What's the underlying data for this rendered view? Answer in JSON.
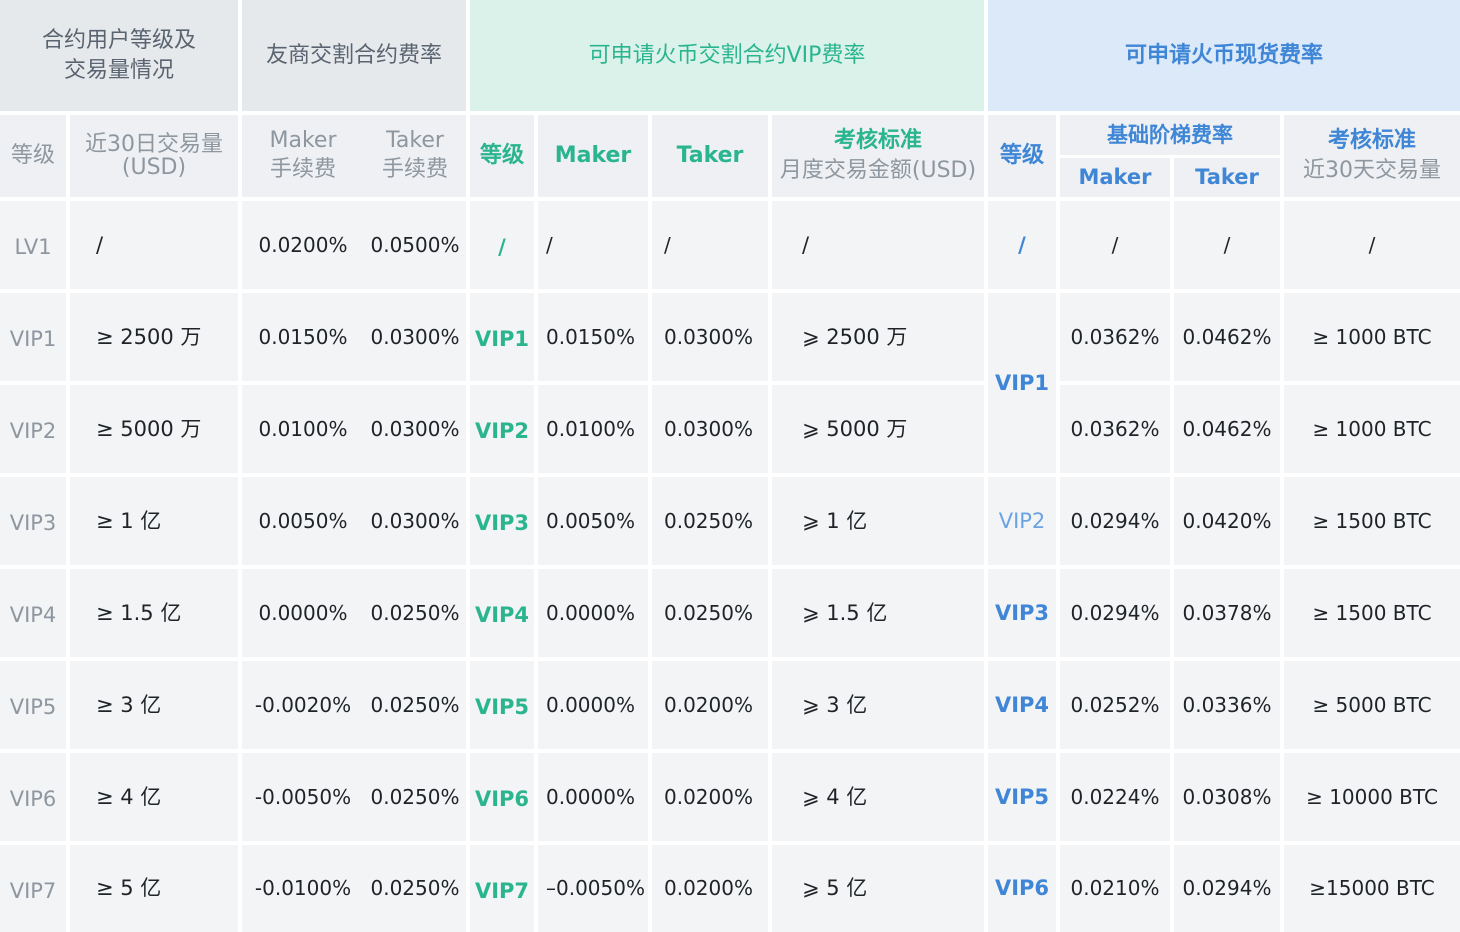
{
  "header": {
    "left_group": "合约用户等级及\n交易量情况",
    "peer_rate": "友商交割合约费率",
    "futures_vip": "可申请火币交割合约VIP费率",
    "spot_rate": "可申请火币现货费率"
  },
  "subheader": {
    "level": "等级",
    "volume": "近30日交易量\n(USD)",
    "peer_maker": "Maker\n手续费",
    "peer_taker": "Taker\n手续费",
    "fut_level": "等级",
    "fut_maker": "Maker",
    "fut_taker": "Taker",
    "fut_criteria_title": "考核标准",
    "fut_criteria_sub": "月度交易金额(USD)",
    "spot_level": "等级",
    "spot_tier_title": "基础阶梯费率",
    "spot_maker": "Maker",
    "spot_taker": "Taker",
    "spot_criteria_title": "考核标准",
    "spot_criteria_sub": "近30天交易量"
  },
  "rows": [
    {
      "level": "LV1",
      "volume": "/",
      "peer_maker": "0.0200%",
      "peer_taker": "0.0500%",
      "fut_level": "/",
      "fut_maker": "/",
      "fut_taker": "/",
      "fut_criteria": "/",
      "spot_maker": "/",
      "spot_taker": "/",
      "spot_criteria": "/"
    },
    {
      "level": "VIP1",
      "volume": "≥ 2500 万",
      "peer_maker": "0.0150%",
      "peer_taker": "0.0300%",
      "fut_level": "VIP1",
      "fut_maker": "0.0150%",
      "fut_taker": "0.0300%",
      "fut_criteria": "⩾ 2500 万",
      "spot_maker": "0.0362%",
      "spot_taker": "0.0462%",
      "spot_criteria": "≥ 1000 BTC"
    },
    {
      "level": "VIP2",
      "volume": "≥ 5000 万",
      "peer_maker": "0.0100%",
      "peer_taker": "0.0300%",
      "fut_level": "VIP2",
      "fut_maker": "0.0100%",
      "fut_taker": "0.0300%",
      "fut_criteria": "⩾ 5000 万",
      "spot_maker": "0.0362%",
      "spot_taker": "0.0462%",
      "spot_criteria": "≥ 1000 BTC"
    },
    {
      "level": "VIP3",
      "volume": "≥ 1 亿",
      "peer_maker": "0.0050%",
      "peer_taker": "0.0300%",
      "fut_level": "VIP3",
      "fut_maker": "0.0050%",
      "fut_taker": "0.0250%",
      "fut_criteria": "⩾ 1 亿",
      "spot_maker": "0.0294%",
      "spot_taker": "0.0420%",
      "spot_criteria": "≥ 1500 BTC"
    },
    {
      "level": "VIP4",
      "volume": "≥ 1.5 亿",
      "peer_maker": "0.0000%",
      "peer_taker": "0.0250%",
      "fut_level": "VIP4",
      "fut_maker": "0.0000%",
      "fut_taker": "0.0250%",
      "fut_criteria": "⩾ 1.5 亿",
      "spot_maker": "0.0294%",
      "spot_taker": "0.0378%",
      "spot_criteria": "≥ 1500 BTC"
    },
    {
      "level": "VIP5",
      "volume": "≥ 3 亿",
      "peer_maker": "-0.0020%",
      "peer_taker": "0.0250%",
      "fut_level": "VIP5",
      "fut_maker": "0.0000%",
      "fut_taker": "0.0200%",
      "fut_criteria": "⩾ 3 亿",
      "spot_maker": "0.0252%",
      "spot_taker": "0.0336%",
      "spot_criteria": "≥ 5000 BTC"
    },
    {
      "level": "VIP6",
      "volume": "≥ 4 亿",
      "peer_maker": "-0.0050%",
      "peer_taker": "0.0250%",
      "fut_level": "VIP6",
      "fut_maker": "0.0000%",
      "fut_taker": "0.0200%",
      "fut_criteria": "⩾ 4 亿",
      "spot_maker": "0.0224%",
      "spot_taker": "0.0308%",
      "spot_criteria": "≥ 10000 BTC"
    },
    {
      "level": "VIP7",
      "volume": "≥ 5 亿",
      "peer_maker": "-0.0100%",
      "peer_taker": "0.0250%",
      "fut_level": "VIP7",
      "fut_maker": "–0.0050%",
      "fut_taker": "0.0200%",
      "fut_criteria": "⩾ 5 亿",
      "spot_maker": "0.0210%",
      "spot_taker": "0.0294%",
      "spot_criteria": "≥15000 BTC"
    }
  ],
  "spot_levels": [
    "/",
    "VIP1",
    "VIP2",
    "VIP3",
    "VIP4",
    "VIP5",
    "VIP6"
  ]
}
